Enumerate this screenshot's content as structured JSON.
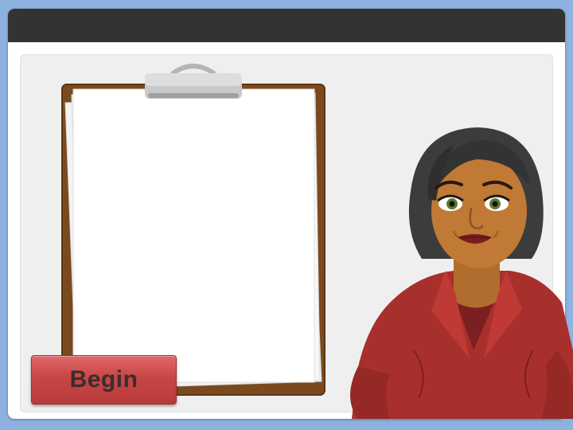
{
  "window": {
    "title": ""
  },
  "clipboard": {
    "sheet_text": ""
  },
  "actions": {
    "begin_label": "Begin"
  },
  "colors": {
    "background": "#8eb2e0",
    "titlebar": "#333333",
    "stage": "#efefef",
    "clipboard_board": "#7a4a1e",
    "button": "#c94545",
    "jacket": "#a8302c",
    "hair": "#3c3c3c",
    "skin": "#c07a35"
  }
}
